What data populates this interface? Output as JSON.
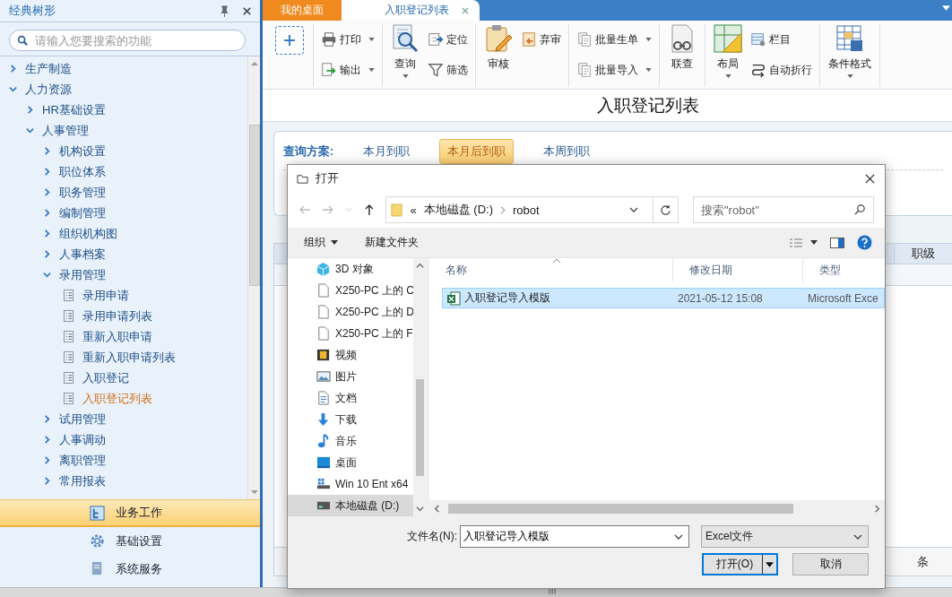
{
  "sidebar": {
    "title": "经典树形",
    "search": {
      "placeholder": "请输入您要搜索的功能"
    },
    "tree": [
      {
        "label": "生产制造",
        "kind": "folder",
        "expanded": false
      },
      {
        "label": "人力资源",
        "kind": "folder",
        "expanded": true,
        "children": [
          {
            "label": "HR基础设置",
            "kind": "folder",
            "expanded": false
          },
          {
            "label": "人事管理",
            "kind": "folder",
            "expanded": true,
            "children": [
              {
                "label": "机构设置",
                "kind": "folder",
                "expanded": false
              },
              {
                "label": "职位体系",
                "kind": "folder",
                "expanded": false
              },
              {
                "label": "职务管理",
                "kind": "folder",
                "expanded": false
              },
              {
                "label": "编制管理",
                "kind": "folder",
                "expanded": false
              },
              {
                "label": "组织机构图",
                "kind": "folder",
                "expanded": false
              },
              {
                "label": "人事档案",
                "kind": "folder",
                "expanded": false
              },
              {
                "label": "录用管理",
                "kind": "folder",
                "expanded": true,
                "children": [
                  {
                    "label": "录用申请",
                    "kind": "page",
                    "selected": false
                  },
                  {
                    "label": "录用申请列表",
                    "kind": "page",
                    "selected": false
                  },
                  {
                    "label": "重新入职申请",
                    "kind": "page",
                    "selected": false
                  },
                  {
                    "label": "重新入职申请列表",
                    "kind": "page",
                    "selected": false
                  },
                  {
                    "label": "入职登记",
                    "kind": "page",
                    "selected": false
                  },
                  {
                    "label": "入职登记列表",
                    "kind": "page",
                    "selected": true
                  }
                ]
              },
              {
                "label": "试用管理",
                "kind": "folder",
                "expanded": false
              },
              {
                "label": "人事调动",
                "kind": "folder",
                "expanded": false
              },
              {
                "label": "离职管理",
                "kind": "folder",
                "expanded": false
              },
              {
                "label": "常用报表",
                "kind": "folder",
                "expanded": false
              }
            ]
          }
        ]
      }
    ],
    "nav": [
      {
        "label": "业务工作",
        "selected": true
      },
      {
        "label": "基础设置",
        "selected": false
      },
      {
        "label": "系统服务",
        "selected": false
      }
    ]
  },
  "tabs": [
    {
      "label": "我的桌面",
      "selected": false
    },
    {
      "label": "入职登记列表",
      "selected": true
    }
  ],
  "toolbar": [
    {
      "buttons": [
        {
          "label": "打印",
          "kind": "small",
          "dropdown": true
        },
        {
          "label": "输出",
          "kind": "small",
          "dropdown": true
        }
      ]
    },
    {
      "buttons": [
        {
          "label": "查询",
          "kind": "large",
          "dropdown": true
        },
        {
          "label": "定位",
          "kind": "small",
          "dropdown": false
        },
        {
          "label": "筛选",
          "kind": "small",
          "dropdown": false
        }
      ]
    },
    {
      "buttons": [
        {
          "label": "审核",
          "kind": "large",
          "dropdown": false
        },
        {
          "label": "弃审",
          "kind": "small",
          "dropdown": false
        }
      ]
    },
    {
      "buttons": [
        {
          "label": "批量生单",
          "kind": "small",
          "dropdown": true
        },
        {
          "label": "批量导入",
          "kind": "small",
          "dropdown": true
        }
      ]
    },
    {
      "buttons": [
        {
          "label": "联查",
          "kind": "large",
          "dropdown": false
        }
      ]
    },
    {
      "buttons": [
        {
          "label": "布局",
          "kind": "large",
          "dropdown": true
        },
        {
          "label": "栏目",
          "kind": "small",
          "dropdown": false
        },
        {
          "label": "自动折行",
          "kind": "small",
          "dropdown": false
        }
      ]
    },
    {
      "buttons": [
        {
          "label": "条件格式",
          "kind": "large",
          "dropdown": true
        }
      ]
    }
  ],
  "page": {
    "title": "入职登记列表",
    "query": {
      "label": "查询方案:",
      "options": [
        {
          "label": "本月到职",
          "selected": false
        },
        {
          "label": "本月后到职",
          "selected": true
        },
        {
          "label": "本周到职",
          "selected": false
        }
      ]
    },
    "grid": {
      "column": "职级"
    },
    "pager": {
      "unit": "条"
    }
  },
  "dialog": {
    "title": "打开",
    "address": {
      "overflow": "«",
      "path": [
        "本地磁盘 (D:)",
        "robot"
      ]
    },
    "search": {
      "placeholder": "搜索\"robot\""
    },
    "commands": [
      "组织",
      "新建文件夹"
    ],
    "places": [
      {
        "label": "3D 对象",
        "selected": false
      },
      {
        "label": "X250-PC 上的 C",
        "selected": false
      },
      {
        "label": "X250-PC 上的 D",
        "selected": false
      },
      {
        "label": "X250-PC 上的 F",
        "selected": false
      },
      {
        "label": "视频",
        "selected": false
      },
      {
        "label": "图片",
        "selected": false
      },
      {
        "label": "文档",
        "selected": false
      },
      {
        "label": "下载",
        "selected": false
      },
      {
        "label": "音乐",
        "selected": false
      },
      {
        "label": "桌面",
        "selected": false
      },
      {
        "label": "Win 10 Ent x64",
        "selected": false
      },
      {
        "label": "本地磁盘 (D:)",
        "selected": true
      }
    ],
    "columns": [
      "名称",
      "修改日期",
      "类型"
    ],
    "files": [
      {
        "name": "入职登记导入模版",
        "modified": "2021-05-12 15:08",
        "type": "Microsoft Exce",
        "selected": true
      }
    ],
    "filename": {
      "label": "文件名(N):",
      "value": "入职登记导入模版"
    },
    "filter": "Excel文件",
    "buttons": [
      "打开(O)",
      "取消"
    ]
  }
}
